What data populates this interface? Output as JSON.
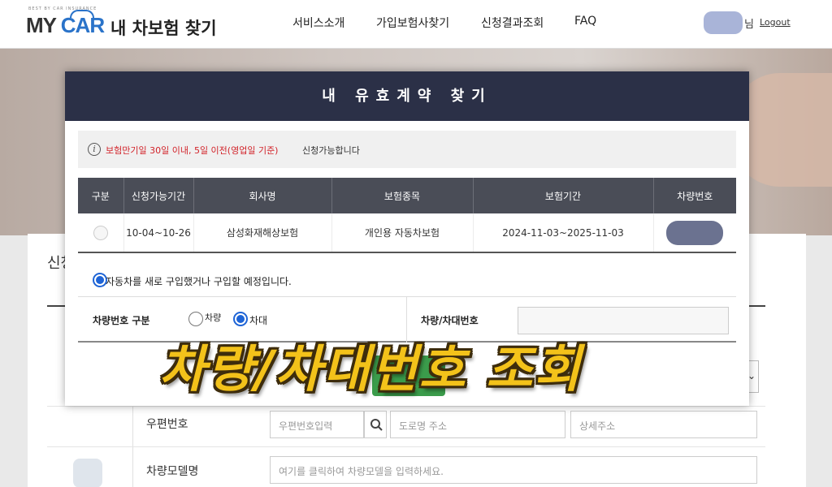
{
  "header": {
    "logo_tiny": "BEST BY CAR INSURANCE",
    "logo_my": "MY ",
    "logo_car": "CAR",
    "logo_sub": "내 차보험 찾기",
    "nav": [
      "서비스소개",
      "가입보험사찾기",
      "신청결과조회",
      "FAQ"
    ],
    "user_suffix": "님",
    "logout": "Logout"
  },
  "background": {
    "section_title": "신청",
    "rows": [
      {
        "label": "우편번호",
        "postcode_placeholder": "우편번호입력",
        "road_placeholder": "도로명 주소",
        "detail_placeholder": "상세주소"
      },
      {
        "label": "차량모델명",
        "model_placeholder": "여기를 클릭하여 차량모델을 입력하세요."
      }
    ]
  },
  "modal": {
    "title": "내 유효계약 찾기",
    "notice_icon": "i",
    "notice_red": "보험만기일 30일 이내, 5일 이전(영업일 기준)",
    "notice_black": "신청가능합니다",
    "table": {
      "headers": [
        "구분",
        "신청가능기간",
        "회사명",
        "보험종목",
        "보험기간",
        "차량번호"
      ],
      "rows": [
        {
          "period": "10-04~10-26",
          "company": "삼성화재해상보험",
          "product": "개인용 자동차보험",
          "term": "2024-11-03~2025-11-03"
        }
      ]
    },
    "new_car_checkbox": {
      "label": "자동차를 새로 구입했거나 구입할 예정입니다.",
      "checked": true
    },
    "plate_type": {
      "label": "차량번호 구분",
      "options": [
        "차량",
        "차대"
      ],
      "selected": "차대"
    },
    "plate_number": {
      "label": "차량/차대번호",
      "value": ""
    }
  },
  "overlay_caption": "차량/차대번호 조회",
  "colors": {
    "modal_header": "#2b3047",
    "table_header": "#4a4d57",
    "notice_red": "#d2232a",
    "radio_blue": "#1e64d6",
    "caption_yellow": "#f3c21a"
  }
}
